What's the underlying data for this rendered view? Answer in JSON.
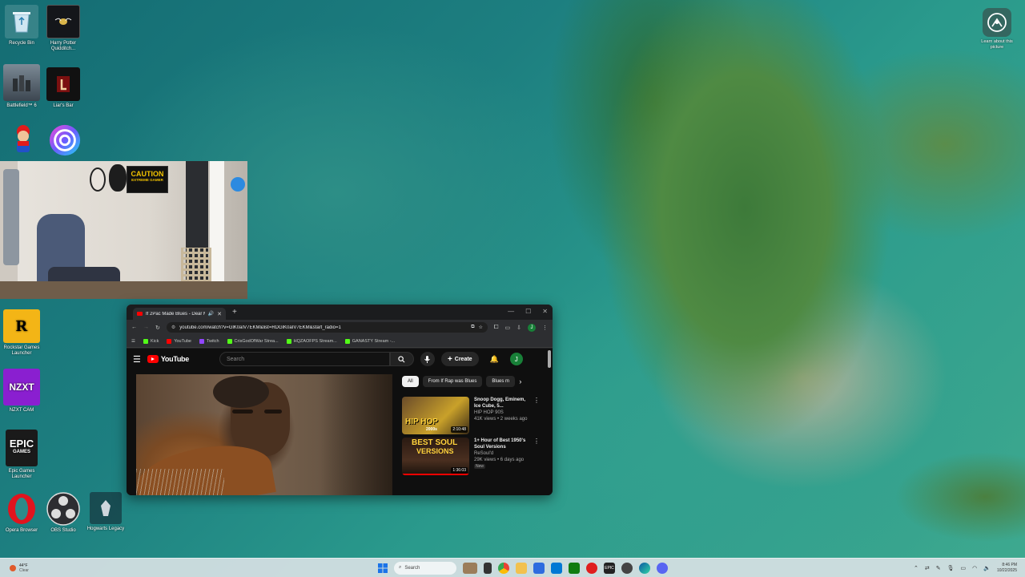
{
  "desktop": {
    "icons": [
      {
        "label": "Recycle Bin",
        "icon": "recycle-bin-icon"
      },
      {
        "label": "Harry Potter Quidditch...",
        "icon": "harry-potter-quidditch-icon"
      },
      {
        "label": "Battlefield™ 6",
        "icon": "battlefield-6-icon"
      },
      {
        "label": "Liar's Bar",
        "icon": "liars-bar-icon"
      },
      {
        "label": "",
        "icon": "mario-icon"
      },
      {
        "label": "",
        "icon": "ubisoft-connect-icon"
      },
      {
        "label": "Rockstar Games Launcher",
        "icon": "rockstar-games-icon"
      },
      {
        "label": "NZXT CAM",
        "icon": "nzxt-cam-icon"
      },
      {
        "label": "Epic Games Launcher",
        "icon": "epic-games-icon"
      },
      {
        "label": "Opera Browser",
        "icon": "opera-icon"
      },
      {
        "label": "OBS Studio",
        "icon": "obs-studio-icon"
      },
      {
        "label": "Hogwarts Legacy",
        "icon": "hogwarts-legacy-icon"
      }
    ],
    "corner_widget": {
      "label": "Learn about this picture",
      "icon": "learn-about-picture-icon"
    }
  },
  "webcam": {
    "sign_line1": "CAUTION",
    "sign_line2": "EXTREME GAMER"
  },
  "browser": {
    "tab_title": "If 2Pac Made Blues - Dear M...",
    "new_tab_symbol": "+",
    "url": "youtube.com/watch?v=GlK0aIV7EKM&list=RDGlK0aIV7EKM&start_radio=1",
    "profile_initial": "J",
    "bookmarks": [
      {
        "label": "Kick",
        "color": "#53fc18"
      },
      {
        "label": "YouTube",
        "color": "#ff0000"
      },
      {
        "label": "Twitch",
        "color": "#9146ff"
      },
      {
        "label": "CrisGodOfWar Strea...",
        "color": "#53fc18"
      },
      {
        "label": "HQZAOFPS Stream...",
        "color": "#53fc18"
      },
      {
        "label": "GANASTY Stream -...",
        "color": "#53fc18"
      }
    ]
  },
  "youtube": {
    "logo_text": "YouTube",
    "search_placeholder": "Search",
    "create_label": "Create",
    "avatar_initial": "J",
    "chips": [
      "All",
      "From If Rap was Blues",
      "Blues m"
    ],
    "recommendations": [
      {
        "title": "Snoop Dogg, Eminem, Ice Cube, 5...",
        "channel": "HIP HOP 90S",
        "meta": "41K views • 2 weeks ago",
        "duration": "2:10:48",
        "thumb_text": "HIP HOP",
        "thumb_sub": "2000s"
      },
      {
        "title": "1+ Hour of Best 1950's Soul Versions",
        "channel": "ReSoul'd",
        "meta": "29K views • 6 days ago",
        "badge": "New",
        "duration": "1:36:03",
        "thumb_text": "BEST SOUL",
        "thumb_sub": "VERSIONS"
      }
    ]
  },
  "taskbar": {
    "weather_temp": "44°F",
    "weather_desc": "Clear",
    "search_label": "Search",
    "time": "8:46 PM",
    "date": "10/22/2025"
  }
}
